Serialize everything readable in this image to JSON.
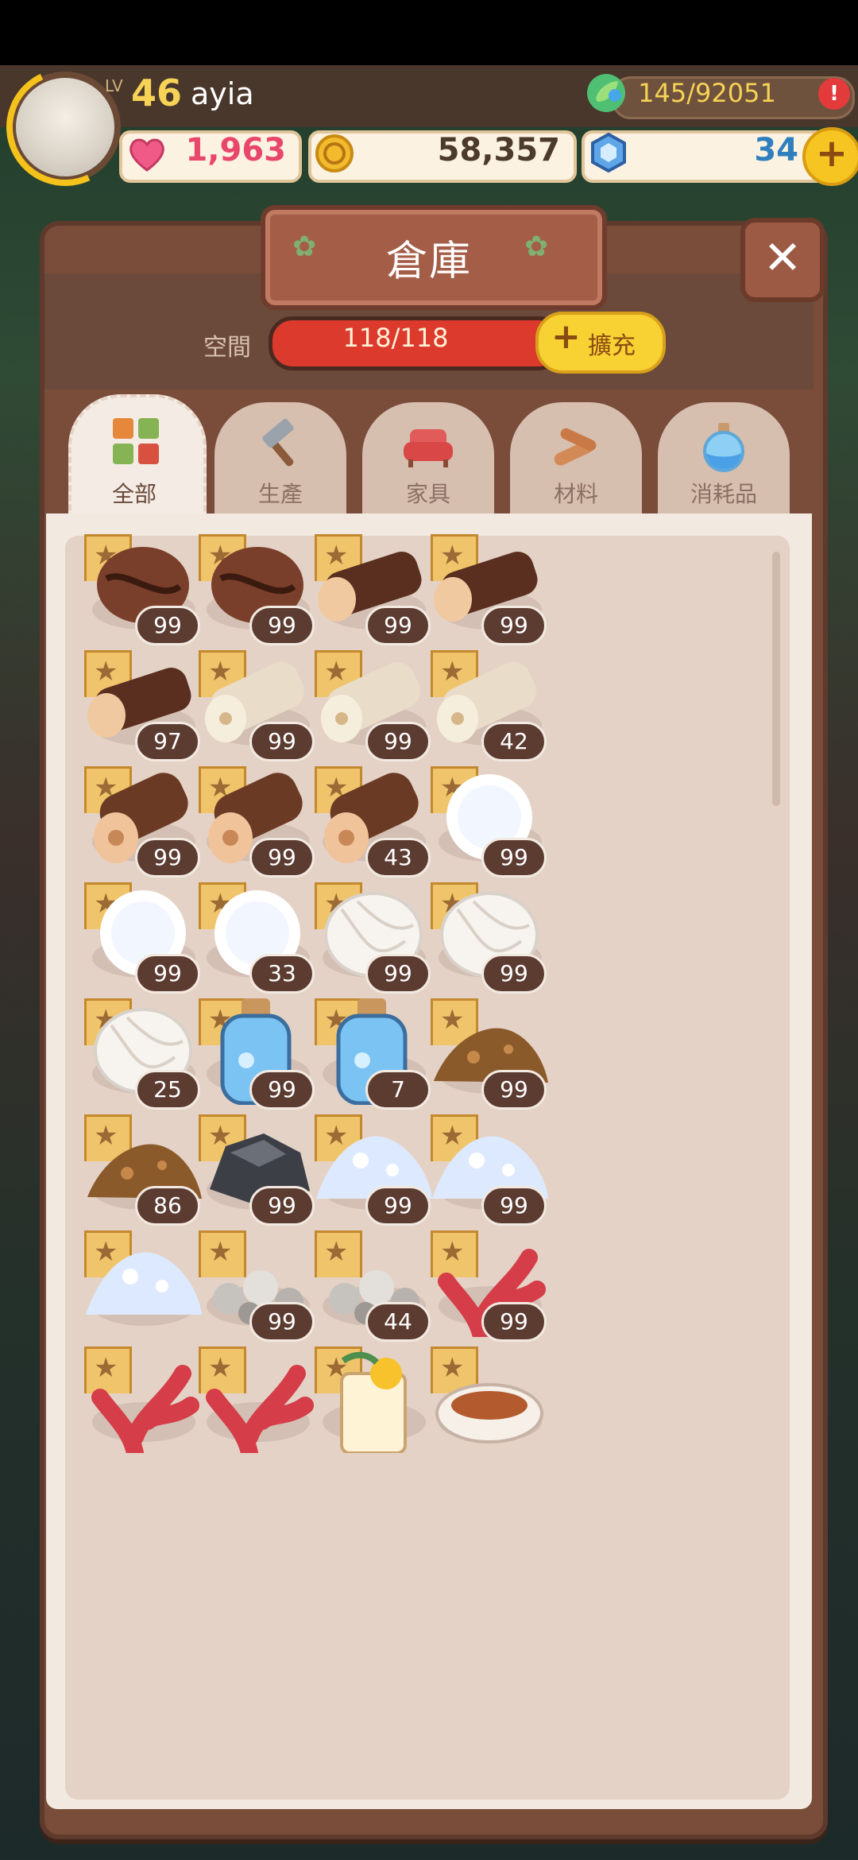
{
  "hud": {
    "level_prefix": "LV",
    "level": "46",
    "player_name": "ayia",
    "energy": "145/92051",
    "alert": "!",
    "hearts": "1,963",
    "coins": "58,357",
    "gems": "34",
    "plus": "+"
  },
  "panel": {
    "title": "倉庫",
    "title_deco_left": "✿",
    "title_deco_right": "✿",
    "close": "✕",
    "space_label": "空間",
    "capacity": "118/118",
    "expand_plus": "+",
    "expand_label": "擴充"
  },
  "tabs": [
    {
      "label": "全部",
      "icon": "grid-icon",
      "active": true
    },
    {
      "label": "生產",
      "icon": "hammer-icon",
      "active": false
    },
    {
      "label": "家具",
      "icon": "sofa-icon",
      "active": false
    },
    {
      "label": "材料",
      "icon": "logs-icon",
      "active": false
    },
    {
      "label": "消耗品",
      "icon": "potion-icon",
      "active": false
    }
  ],
  "items": [
    {
      "icon": "coffee-bean-icon",
      "count": "99"
    },
    {
      "icon": "coffee-bean-icon",
      "count": "99"
    },
    {
      "icon": "dark-log-icon",
      "count": "99"
    },
    {
      "icon": "dark-log-icon",
      "count": "99"
    },
    {
      "icon": "dark-log-icon",
      "count": "97"
    },
    {
      "icon": "birch-log-icon",
      "count": "99"
    },
    {
      "icon": "birch-log-icon",
      "count": "99"
    },
    {
      "icon": "birch-log-icon",
      "count": "42"
    },
    {
      "icon": "oak-log-icon",
      "count": "99"
    },
    {
      "icon": "oak-log-icon",
      "count": "99"
    },
    {
      "icon": "oak-log-icon",
      "count": "43"
    },
    {
      "icon": "cotton-icon",
      "count": "99"
    },
    {
      "icon": "cotton-icon",
      "count": "99"
    },
    {
      "icon": "cotton-icon",
      "count": "33"
    },
    {
      "icon": "wool-icon",
      "count": "99"
    },
    {
      "icon": "wool-icon",
      "count": "99"
    },
    {
      "icon": "wool-icon",
      "count": "25"
    },
    {
      "icon": "water-bottle-icon",
      "count": "99"
    },
    {
      "icon": "water-bottle-icon",
      "count": "7"
    },
    {
      "icon": "soil-pile-icon",
      "count": "99"
    },
    {
      "icon": "soil-pile-icon",
      "count": "86"
    },
    {
      "icon": "coal-icon",
      "count": "99"
    },
    {
      "icon": "salt-icon",
      "count": "99"
    },
    {
      "icon": "salt-icon",
      "count": "99"
    },
    {
      "icon": "salt-icon",
      "count": ""
    },
    {
      "icon": "pebbles-icon",
      "count": "99"
    },
    {
      "icon": "pebbles-icon",
      "count": "44"
    },
    {
      "icon": "red-coral-icon",
      "count": "99"
    },
    {
      "icon": "red-coral-icon",
      "count": ""
    },
    {
      "icon": "red-coral-icon",
      "count": ""
    },
    {
      "icon": "lemon-drink-icon",
      "count": ""
    },
    {
      "icon": "tea-cup-icon",
      "count": ""
    }
  ],
  "colors": {
    "accent": "#dd3a2e",
    "panel": "#7a4c3a",
    "gold": "#f8d233"
  }
}
